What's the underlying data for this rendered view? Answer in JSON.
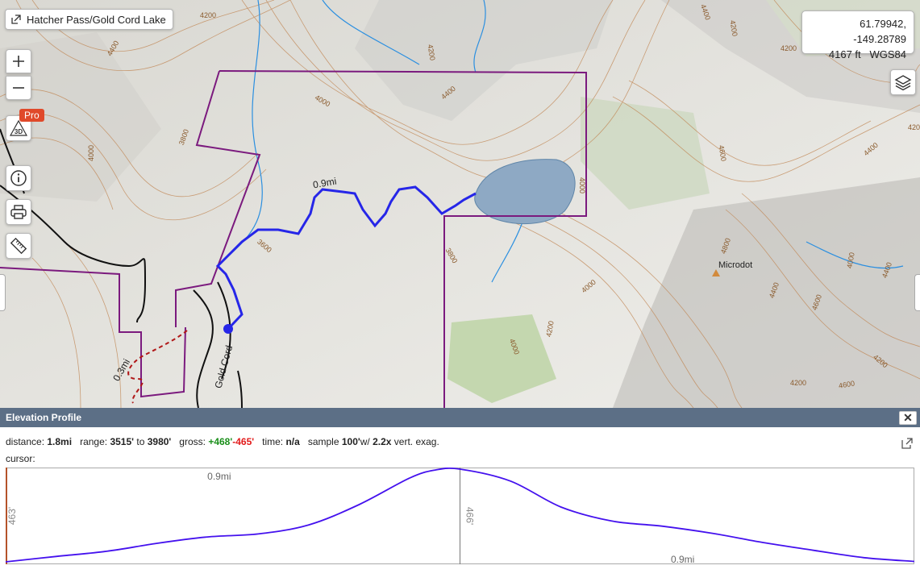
{
  "map": {
    "title": "Hatcher Pass/Gold Cord Lake",
    "coords": {
      "latlon": "61.79942, -149.28789",
      "elevation": "4167 ft",
      "datum": "WGS84"
    },
    "pro_badge": "Pro",
    "labels": {
      "segment_distance": "0.9mi",
      "trail_distance": "0.3mi",
      "road_name": "Gold Cord",
      "peak_name": "Microdot"
    },
    "contours": [
      "4200",
      "4400",
      "4200",
      "4400",
      "4200",
      "4000",
      "4400",
      "4000",
      "4200",
      "4200",
      "3800",
      "4000",
      "3600",
      "3800",
      "4000",
      "4200",
      "4000",
      "4400",
      "4600",
      "4800",
      "4000",
      "4600",
      "4400",
      "4200",
      "4600",
      "4400",
      "4200"
    ],
    "colors": {
      "track": "#2626e8",
      "boundary": "#7b1a7e",
      "water": "#8ea9c4",
      "contour": "#b8763e",
      "stream": "#2b8fe0"
    }
  },
  "elevation_profile": {
    "title": "Elevation Profile",
    "close_label": "✕",
    "stats": {
      "distance_label": "distance:",
      "distance": "1.8mi",
      "range_label": "range:",
      "range_low": "3515'",
      "range_to": "to",
      "range_high": "3980'",
      "gross_label": "gross:",
      "gain": "+468'",
      "loss": "-465'",
      "time_label": "time:",
      "time": "n/a",
      "sample_label": "sample",
      "sample": "100'",
      "sample_w": "w/",
      "exag": "2.2x",
      "exag_label": "vert. exag."
    },
    "cursor_label": "cursor:"
  },
  "chart_data": {
    "type": "line",
    "segments": [
      {
        "distance_label": "0.9mi",
        "gain_label": "463'"
      },
      {
        "distance_label": "0.9mi",
        "gain_label": "466'"
      }
    ],
    "x": [
      0,
      0.1,
      0.2,
      0.3,
      0.4,
      0.5,
      0.6,
      0.7,
      0.8,
      0.85,
      0.9,
      1.0,
      1.1,
      1.2,
      1.3,
      1.4,
      1.5,
      1.6,
      1.7,
      1.8
    ],
    "y": [
      3515,
      3542,
      3568,
      3608,
      3640,
      3655,
      3700,
      3802,
      3935,
      3975,
      3980,
      3920,
      3790,
      3720,
      3694,
      3658,
      3612,
      3573,
      3536,
      3517
    ],
    "xlim": [
      0,
      1.8
    ],
    "ylim": [
      3515,
      3980
    ],
    "line_color": "#4411ee"
  }
}
